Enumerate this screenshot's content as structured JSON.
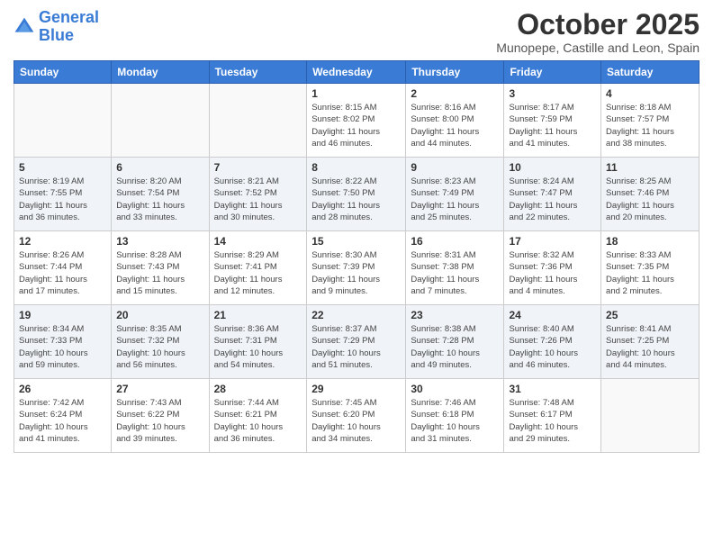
{
  "header": {
    "logo_line1": "General",
    "logo_line2": "Blue",
    "title": "October 2025",
    "subtitle": "Munopepe, Castille and Leon, Spain"
  },
  "columns": [
    "Sunday",
    "Monday",
    "Tuesday",
    "Wednesday",
    "Thursday",
    "Friday",
    "Saturday"
  ],
  "weeks": [
    [
      {
        "day": "",
        "info": ""
      },
      {
        "day": "",
        "info": ""
      },
      {
        "day": "",
        "info": ""
      },
      {
        "day": "1",
        "info": "Sunrise: 8:15 AM\nSunset: 8:02 PM\nDaylight: 11 hours\nand 46 minutes."
      },
      {
        "day": "2",
        "info": "Sunrise: 8:16 AM\nSunset: 8:00 PM\nDaylight: 11 hours\nand 44 minutes."
      },
      {
        "day": "3",
        "info": "Sunrise: 8:17 AM\nSunset: 7:59 PM\nDaylight: 11 hours\nand 41 minutes."
      },
      {
        "day": "4",
        "info": "Sunrise: 8:18 AM\nSunset: 7:57 PM\nDaylight: 11 hours\nand 38 minutes."
      }
    ],
    [
      {
        "day": "5",
        "info": "Sunrise: 8:19 AM\nSunset: 7:55 PM\nDaylight: 11 hours\nand 36 minutes."
      },
      {
        "day": "6",
        "info": "Sunrise: 8:20 AM\nSunset: 7:54 PM\nDaylight: 11 hours\nand 33 minutes."
      },
      {
        "day": "7",
        "info": "Sunrise: 8:21 AM\nSunset: 7:52 PM\nDaylight: 11 hours\nand 30 minutes."
      },
      {
        "day": "8",
        "info": "Sunrise: 8:22 AM\nSunset: 7:50 PM\nDaylight: 11 hours\nand 28 minutes."
      },
      {
        "day": "9",
        "info": "Sunrise: 8:23 AM\nSunset: 7:49 PM\nDaylight: 11 hours\nand 25 minutes."
      },
      {
        "day": "10",
        "info": "Sunrise: 8:24 AM\nSunset: 7:47 PM\nDaylight: 11 hours\nand 22 minutes."
      },
      {
        "day": "11",
        "info": "Sunrise: 8:25 AM\nSunset: 7:46 PM\nDaylight: 11 hours\nand 20 minutes."
      }
    ],
    [
      {
        "day": "12",
        "info": "Sunrise: 8:26 AM\nSunset: 7:44 PM\nDaylight: 11 hours\nand 17 minutes."
      },
      {
        "day": "13",
        "info": "Sunrise: 8:28 AM\nSunset: 7:43 PM\nDaylight: 11 hours\nand 15 minutes."
      },
      {
        "day": "14",
        "info": "Sunrise: 8:29 AM\nSunset: 7:41 PM\nDaylight: 11 hours\nand 12 minutes."
      },
      {
        "day": "15",
        "info": "Sunrise: 8:30 AM\nSunset: 7:39 PM\nDaylight: 11 hours\nand 9 minutes."
      },
      {
        "day": "16",
        "info": "Sunrise: 8:31 AM\nSunset: 7:38 PM\nDaylight: 11 hours\nand 7 minutes."
      },
      {
        "day": "17",
        "info": "Sunrise: 8:32 AM\nSunset: 7:36 PM\nDaylight: 11 hours\nand 4 minutes."
      },
      {
        "day": "18",
        "info": "Sunrise: 8:33 AM\nSunset: 7:35 PM\nDaylight: 11 hours\nand 2 minutes."
      }
    ],
    [
      {
        "day": "19",
        "info": "Sunrise: 8:34 AM\nSunset: 7:33 PM\nDaylight: 10 hours\nand 59 minutes."
      },
      {
        "day": "20",
        "info": "Sunrise: 8:35 AM\nSunset: 7:32 PM\nDaylight: 10 hours\nand 56 minutes."
      },
      {
        "day": "21",
        "info": "Sunrise: 8:36 AM\nSunset: 7:31 PM\nDaylight: 10 hours\nand 54 minutes."
      },
      {
        "day": "22",
        "info": "Sunrise: 8:37 AM\nSunset: 7:29 PM\nDaylight: 10 hours\nand 51 minutes."
      },
      {
        "day": "23",
        "info": "Sunrise: 8:38 AM\nSunset: 7:28 PM\nDaylight: 10 hours\nand 49 minutes."
      },
      {
        "day": "24",
        "info": "Sunrise: 8:40 AM\nSunset: 7:26 PM\nDaylight: 10 hours\nand 46 minutes."
      },
      {
        "day": "25",
        "info": "Sunrise: 8:41 AM\nSunset: 7:25 PM\nDaylight: 10 hours\nand 44 minutes."
      }
    ],
    [
      {
        "day": "26",
        "info": "Sunrise: 7:42 AM\nSunset: 6:24 PM\nDaylight: 10 hours\nand 41 minutes."
      },
      {
        "day": "27",
        "info": "Sunrise: 7:43 AM\nSunset: 6:22 PM\nDaylight: 10 hours\nand 39 minutes."
      },
      {
        "day": "28",
        "info": "Sunrise: 7:44 AM\nSunset: 6:21 PM\nDaylight: 10 hours\nand 36 minutes."
      },
      {
        "day": "29",
        "info": "Sunrise: 7:45 AM\nSunset: 6:20 PM\nDaylight: 10 hours\nand 34 minutes."
      },
      {
        "day": "30",
        "info": "Sunrise: 7:46 AM\nSunset: 6:18 PM\nDaylight: 10 hours\nand 31 minutes."
      },
      {
        "day": "31",
        "info": "Sunrise: 7:48 AM\nSunset: 6:17 PM\nDaylight: 10 hours\nand 29 minutes."
      },
      {
        "day": "",
        "info": ""
      }
    ]
  ]
}
